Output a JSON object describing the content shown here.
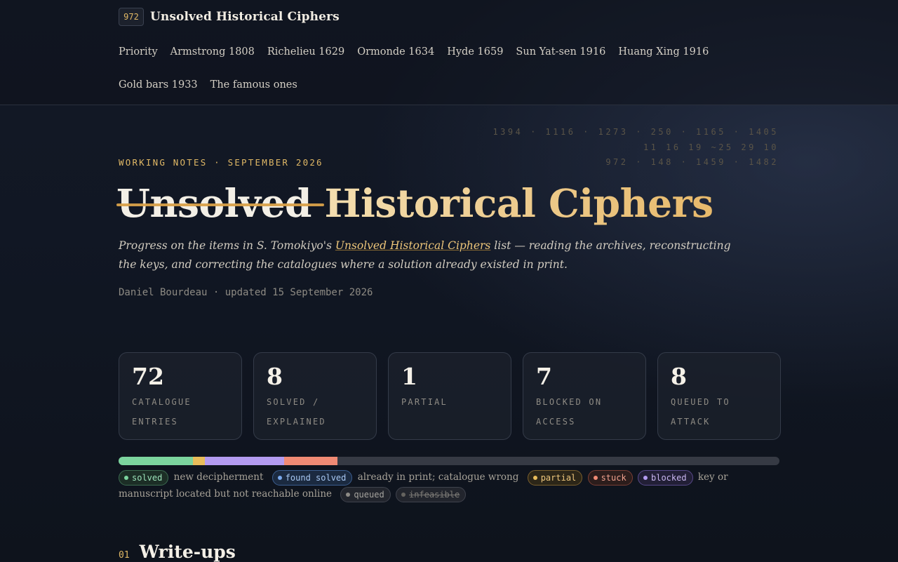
{
  "header": {
    "badge": "972",
    "site_title": "Unsolved Historical Ciphers",
    "nav": [
      "Priority",
      "Armstrong 1808",
      "Richelieu 1629",
      "Ormonde 1634",
      "Hyde 1659",
      "Sun Yat-sen 1916",
      "Huang Xing 1916",
      "Gold bars 1933",
      "The famous ones"
    ]
  },
  "hero": {
    "cipher_lines": [
      "1394 · 1116 · 1273 · 250 · 1165 · 1405",
      "11 16 19 ~25 29 10",
      "972 · 148 · 1459 · 1482"
    ],
    "kicker": "WORKING NOTES · SEPTEMBER 2026",
    "title_struck": "Unsolved",
    "title_rest": " Historical Ciphers",
    "lede_before": "Progress on the items in S. Tomokiyo's ",
    "lede_link": "Unsolved Historical Ciphers",
    "lede_after": " list — reading the archives, reconstructing the keys, and correcting the catalogues where a solution already existed in print.",
    "byline": "Daniel Bourdeau · updated 15 September 2026"
  },
  "stats": [
    {
      "value": "72",
      "label": "CATALOGUE ENTRIES"
    },
    {
      "value": "8",
      "label": "SOLVED / EXPLAINED"
    },
    {
      "value": "1",
      "label": "PARTIAL"
    },
    {
      "value": "7",
      "label": "BLOCKED ON ACCESS"
    },
    {
      "value": "8",
      "label": "QUEUED TO ATTACK"
    }
  ],
  "progress": {
    "segments": [
      {
        "name": "solved",
        "fraction": 0.112,
        "color": "#7cd49e"
      },
      {
        "name": "partial",
        "fraction": 0.019,
        "color": "#e8bc5a"
      },
      {
        "name": "blocked",
        "fraction": 0.12,
        "color": "#b39bf0"
      },
      {
        "name": "stuck",
        "fraction": 0.08,
        "color": "#f08a74"
      }
    ],
    "track_color": "#363a44"
  },
  "legend": {
    "solved": {
      "pill": "solved",
      "desc": "new decipherment"
    },
    "found": {
      "pill": "found solved",
      "desc": "already in print; catalogue wrong"
    },
    "partial": {
      "pill": "partial"
    },
    "stuck": {
      "pill": "stuck"
    },
    "blocked": {
      "pill": "blocked",
      "desc": "key or manuscript located but not reachable online"
    },
    "queued": {
      "pill": "queued"
    },
    "infeasible": {
      "pill": "infeasible"
    }
  },
  "section": {
    "number": "01",
    "title": "Write-ups"
  }
}
